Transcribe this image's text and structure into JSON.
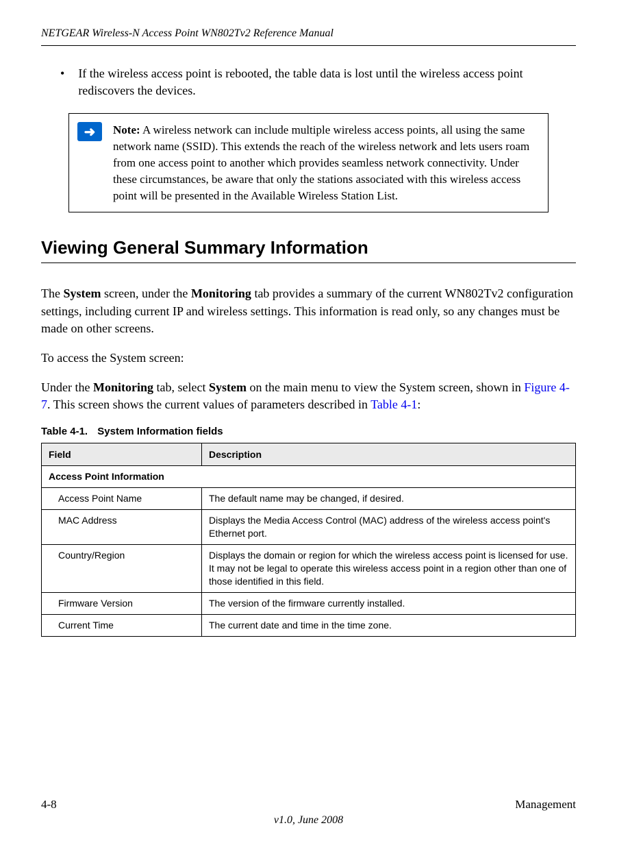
{
  "header": {
    "title": "NETGEAR Wireless-N Access Point WN802Tv2 Reference Manual"
  },
  "bullet": {
    "marker": "•",
    "text": "If the wireless access point is rebooted, the table data is lost until the wireless access point rediscovers the devices."
  },
  "note": {
    "label": "Note:",
    "text": "A wireless network can include multiple wireless access points, all using the same network name (SSID). This extends the reach of the wireless network and lets users roam from one access point to another which provides seamless network connectivity. Under these circumstances, be aware that only the stations associated with this wireless access point will be presented in the Available Wireless Station List."
  },
  "section_heading": "Viewing General Summary Information",
  "intro": {
    "p1_pre": "The ",
    "p1_b1": "System",
    "p1_mid1": " screen, under the ",
    "p1_b2": "Monitoring",
    "p1_post": " tab provides a summary of the current WN802Tv2 configuration settings, including current IP and wireless settings. This information is read only, so any changes must be made on other screens.",
    "p2": "To access the System screen:",
    "p3_pre": "Under the ",
    "p3_b1": "Monitoring",
    "p3_mid1": " tab, select ",
    "p3_b2": "System",
    "p3_mid2": " on the main menu to view the System screen, shown in ",
    "p3_link1": "Figure 4-7",
    "p3_mid3": ". This screen shows the current values of parameters described in ",
    "p3_link2": "Table 4-1",
    "p3_post": ":"
  },
  "table": {
    "caption_num": "Table 4-1.",
    "caption_title": "System Information fields",
    "col_field": "Field",
    "col_desc": "Description",
    "section_header": "Access Point Information",
    "rows": [
      {
        "field": "Access Point Name",
        "desc": "The default name may be changed, if desired."
      },
      {
        "field": "MAC Address",
        "desc": "Displays the Media Access Control (MAC) address of the wireless access point's Ethernet port."
      },
      {
        "field": "Country/Region",
        "desc": "Displays the domain or region for which the wireless access point is licensed for use. It may not be legal to operate this wireless access point in a region other than one of those identified in this field."
      },
      {
        "field": "Firmware Version",
        "desc": "The version of the firmware currently installed."
      },
      {
        "field": "Current Time",
        "desc": "The current date and time in the time zone."
      }
    ]
  },
  "footer": {
    "page": "4-8",
    "section": "Management",
    "version": "v1.0, June 2008"
  }
}
